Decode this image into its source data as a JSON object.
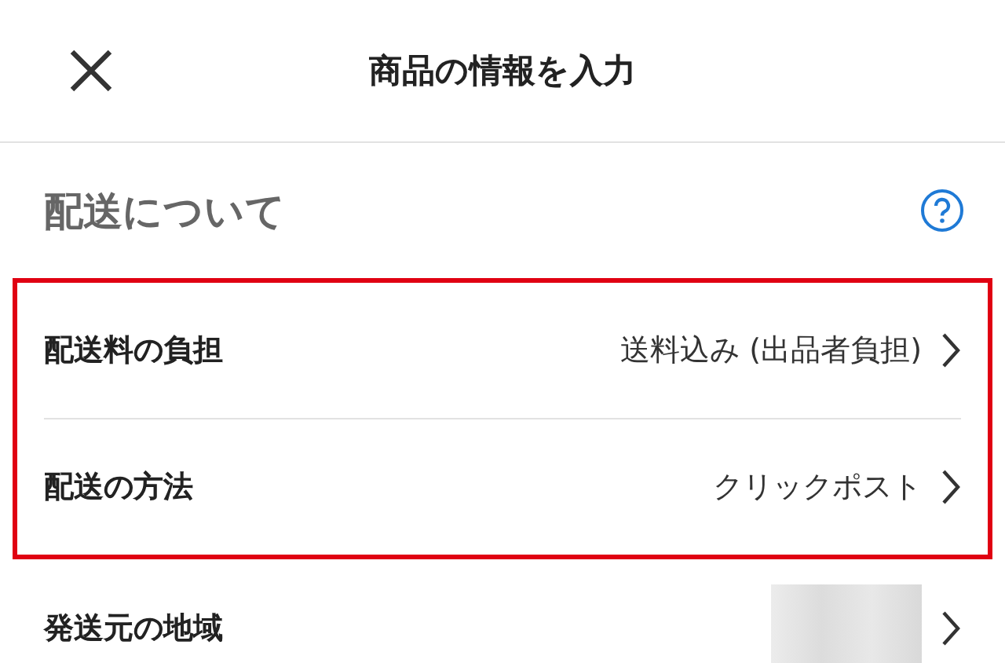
{
  "header": {
    "title": "商品の情報を入力"
  },
  "section": {
    "title": "配送について"
  },
  "rows": [
    {
      "label": "配送料の負担",
      "kind": "text",
      "value": "送料込み (出品者負担)",
      "highlighted": true
    },
    {
      "label": "配送の方法",
      "kind": "text",
      "value": "クリックポスト",
      "highlighted": true
    },
    {
      "label": "発送元の地域",
      "kind": "blurred",
      "highlighted": false
    }
  ]
}
